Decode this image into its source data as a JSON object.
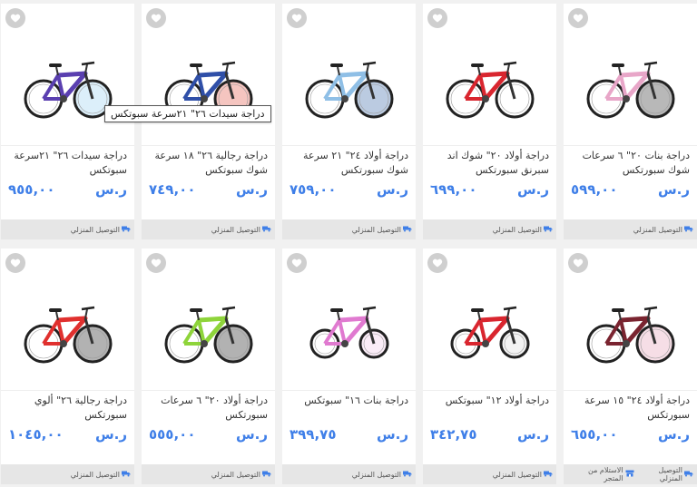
{
  "tooltip": "دراجة سيدات ٢٦\" ٢١سرعة سبوتكس",
  "shipping_label": "التوصيل المنزلي",
  "pickup_label": "الاستلام من المتجر",
  "products": [
    {
      "title": "دراجة بنات ٢٠\" ٦ سرعات شوك سبورتكس",
      "price": "٥٩٩,٠٠",
      "currency": "ر.س",
      "frame": "#e8a6c8",
      "accent": "#333"
    },
    {
      "title": "دراجة أولاد ٢٠\" شوك اند سبرنق سبورتكس",
      "price": "٦٩٩,٠٠",
      "currency": "ر.س",
      "frame": "#d9262f",
      "accent": "#fff"
    },
    {
      "title": "دراجة أولاد ٢٤\" ٢١ سرعة شوك سبورتكس",
      "price": "٧٥٩,٠٠",
      "currency": "ر.س",
      "frame": "#8fbfe6",
      "accent": "#3b6aa8"
    },
    {
      "title": "دراجة رجالية ٢٦\" ١٨ سرعة شوك سبوتكس",
      "price": "٧٤٩,٠٠",
      "currency": "ر.س",
      "frame": "#2f4fa8",
      "accent": "#e25a4a"
    },
    {
      "title": "دراجة سيدات ٢٦\" ٢١سرعة سبوتكس",
      "price": "٩٥٥,٠٠",
      "currency": "ر.س",
      "frame": "#5a3fb0",
      "accent": "#9ad0f2"
    },
    {
      "title": "دراجة أولاد ٢٤\" ١٥ سرعة سبورتكس",
      "price": "٦٥٥,٠٠",
      "currency": "ر.س",
      "frame": "#7a2430",
      "accent": "#e6a0b8",
      "pickup": true
    },
    {
      "title": "دراجة أولاد ١٢\" سبوتكس",
      "price": "٣٤٢,٧٥",
      "currency": "ر.س",
      "frame": "#d9262f",
      "accent": "#ddd"
    },
    {
      "title": "دراجة بنات ١٦\" سبوتكس",
      "price": "٣٩٩,٧٥",
      "currency": "ر.س",
      "frame": "#e07ad0",
      "accent": "#f2c8e8"
    },
    {
      "title": "دراجة أولاد ٢٠\" ٦ سرعات سبورتكس",
      "price": "٥٥٥,٠٠",
      "currency": "ر.س",
      "frame": "#8ed43a",
      "accent": "#222"
    },
    {
      "title": "دراجة رجالية ٢٦\" ألوي سبورتكس",
      "price": "١٠٤٥,٠٠",
      "currency": "ر.س",
      "frame": "#e0302e",
      "accent": "#222"
    }
  ]
}
